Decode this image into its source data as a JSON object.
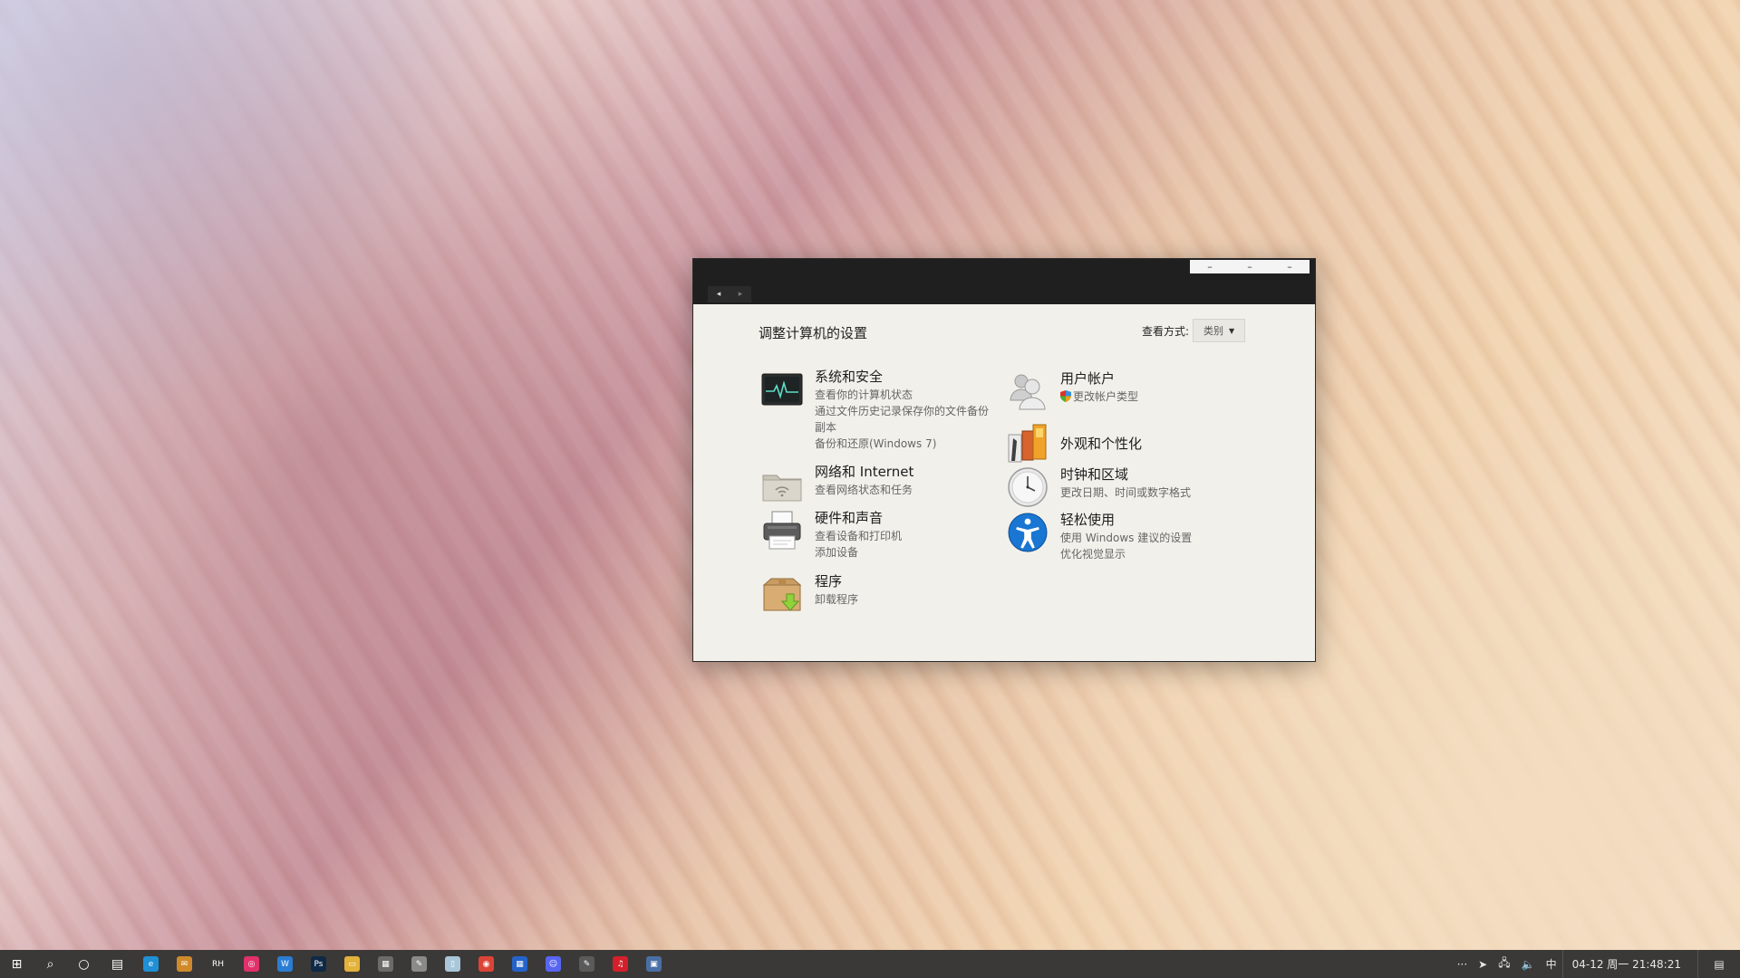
{
  "window": {
    "controls": {
      "minimize": "–",
      "maximize": "–",
      "close": "–"
    },
    "nav": {
      "back": "◂",
      "forward": "▸"
    }
  },
  "header": {
    "title": "调整计算机的设置",
    "view_by_label": "查看方式:",
    "view_by_value": "类别"
  },
  "left_categories": [
    {
      "title": "系统和安全",
      "links": [
        "查看你的计算机状态",
        "通过文件历史记录保存你的文件备份",
        "副本",
        "备份和还原(Windows 7)"
      ]
    },
    {
      "title": "网络和 Internet",
      "links": [
        "查看网络状态和任务"
      ]
    },
    {
      "title": "硬件和声音",
      "links": [
        "查看设备和打印机",
        "添加设备"
      ]
    },
    {
      "title": "程序",
      "links": [
        "卸载程序"
      ]
    }
  ],
  "right_categories": [
    {
      "title": "用户帐户",
      "links": [
        "更改帐户类型"
      ]
    },
    {
      "title": "外观和个性化",
      "links": []
    },
    {
      "title": "时钟和区域",
      "links": [
        "更改日期、时间或数字格式"
      ]
    },
    {
      "title": "轻松使用",
      "links": [
        "使用 Windows 建议的设置",
        "优化视觉显示"
      ]
    }
  ],
  "taskbar": {
    "apps": [
      {
        "name": "start-icon",
        "glyph": "⊞",
        "color": "#3b3937"
      },
      {
        "name": "search-icon",
        "glyph": "⌕",
        "color": "#3b3937"
      },
      {
        "name": "cortana-icon",
        "glyph": "○",
        "color": "#3b3937"
      },
      {
        "name": "task-view-icon",
        "glyph": "▤",
        "color": "#3b3937"
      },
      {
        "name": "edge-icon",
        "glyph": "e",
        "color": "#1f8fd6"
      },
      {
        "name": "mail-icon",
        "glyph": "✉",
        "color": "#d08a2c"
      },
      {
        "name": "rh-icon",
        "glyph": "RH",
        "color": "#3b3937"
      },
      {
        "name": "instagram-icon",
        "glyph": "◎",
        "color": "#e1306c"
      },
      {
        "name": "word-icon",
        "glyph": "W",
        "color": "#2b7cd3"
      },
      {
        "name": "photoshop-icon",
        "glyph": "Ps",
        "color": "#0e2a47"
      },
      {
        "name": "file-explorer-icon",
        "glyph": "▭",
        "color": "#e3b23c"
      },
      {
        "name": "calculator-icon",
        "glyph": "▦",
        "color": "#6b6b6b"
      },
      {
        "name": "notepad-icon",
        "glyph": "✎",
        "color": "#8a8a8a"
      },
      {
        "name": "notes-icon",
        "glyph": "▯",
        "color": "#a9c7d9"
      },
      {
        "name": "chrome-icon",
        "glyph": "◉",
        "color": "#db4437"
      },
      {
        "name": "store-icon",
        "glyph": "▦",
        "color": "#2563c9"
      },
      {
        "name": "discord-icon",
        "glyph": "☺",
        "color": "#5865f2"
      },
      {
        "name": "editor-icon",
        "glyph": "✎",
        "color": "#5a5a5a"
      },
      {
        "name": "netease-music-icon",
        "glyph": "♫",
        "color": "#d3202b"
      },
      {
        "name": "control-panel-icon",
        "glyph": "▣",
        "color": "#4a6fa5"
      }
    ],
    "tray": {
      "more": "···",
      "plane": "➤",
      "network": "🖧",
      "volume": "🔈",
      "ime": "中",
      "clock": "04-12 周一 21:48:21",
      "notifications": "▤"
    }
  }
}
